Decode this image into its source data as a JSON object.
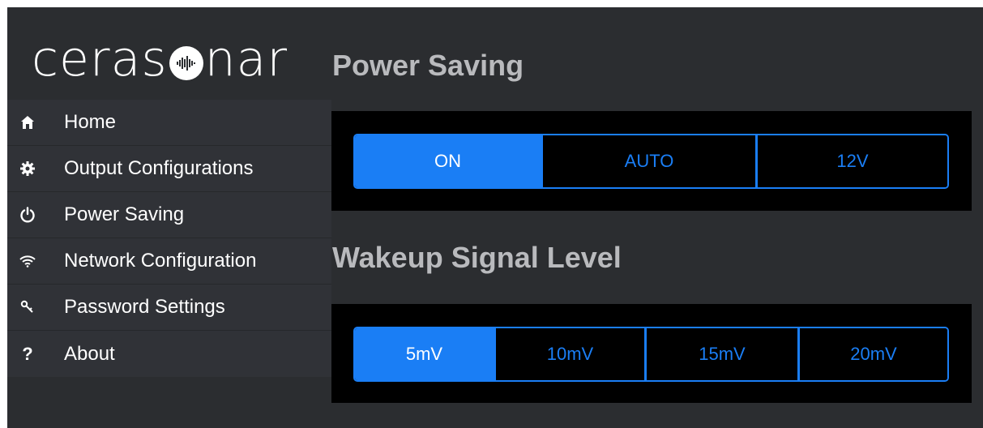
{
  "logo": {
    "text_before": "ceras",
    "text_after": "nar"
  },
  "sidebar": {
    "items": [
      {
        "label": "Home",
        "icon": "home-icon"
      },
      {
        "label": "Output Configurations",
        "icon": "gear-icon"
      },
      {
        "label": "Power Saving",
        "icon": "power-icon"
      },
      {
        "label": "Network Configuration",
        "icon": "wifi-icon"
      },
      {
        "label": "Password Settings",
        "icon": "key-icon"
      },
      {
        "label": "About",
        "icon": "question-icon"
      }
    ]
  },
  "power_saving": {
    "title": "Power Saving",
    "options": [
      "ON",
      "AUTO",
      "12V"
    ],
    "selected": "ON"
  },
  "wakeup": {
    "title": "Wakeup Signal Level",
    "options": [
      "5mV",
      "10mV",
      "15mV",
      "20mV"
    ],
    "selected": "5mV"
  },
  "colors": {
    "accent": "#1a7ef5",
    "background": "#2b2d30",
    "sidebar": "#303237",
    "panel": "#000000",
    "title": "#b9babd"
  }
}
